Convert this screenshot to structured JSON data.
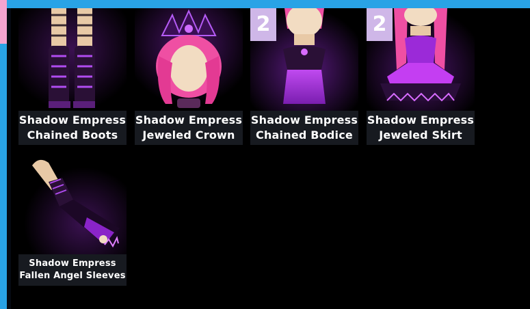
{
  "items": [
    {
      "line1": "Shadow Empress",
      "line2": "Chained Boots"
    },
    {
      "line1": "Shadow Empress",
      "line2": "Jeweled Crown"
    },
    {
      "line1": "Shadow Empress",
      "line2": "Chained Bodice",
      "badge": "2"
    },
    {
      "line1": "Shadow Empress",
      "line2": "Jeweled Skirt",
      "badge": "2"
    },
    {
      "line1": "Shadow Empress",
      "line2": "Fallen Angel Sleeves"
    }
  ],
  "colors": {
    "frame_blue": "#29a3e6",
    "frame_pink": "#f3a4d0",
    "label_bg": "#171a20",
    "badge_bg": "#cfb7e8",
    "accent_purple": "#a33ee0",
    "hair_pink": "#ef4fa3"
  },
  "icons": [
    "boots-icon",
    "crown-icon",
    "bodice-icon",
    "skirt-icon",
    "sleeve-icon"
  ]
}
